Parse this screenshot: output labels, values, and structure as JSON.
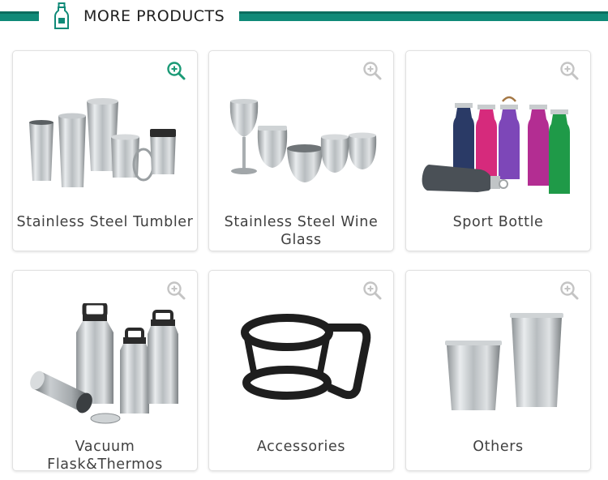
{
  "header": {
    "title": "MORE PRODUCTS",
    "accent": "#108a78",
    "icon": "bottle-icon"
  },
  "products": [
    {
      "label": "Stainless Steel Tumbler",
      "icon": "zoom-in-icon",
      "active": true
    },
    {
      "label": "Stainless Steel Wine Glass",
      "icon": "zoom-in-icon",
      "active": false
    },
    {
      "label": "Sport Bottle",
      "icon": "zoom-in-icon",
      "active": false
    },
    {
      "label": "Vacuum Flask&Thermos",
      "icon": "zoom-in-icon",
      "active": false
    },
    {
      "label": "Accessories",
      "icon": "zoom-in-icon",
      "active": false
    },
    {
      "label": "Others",
      "icon": "zoom-in-icon",
      "active": false
    }
  ],
  "colors": {
    "zoom_active": "#1a9a76",
    "zoom_inactive": "#c4c4c4",
    "card_border": "#e1e1e1",
    "label_text": "#404040"
  }
}
